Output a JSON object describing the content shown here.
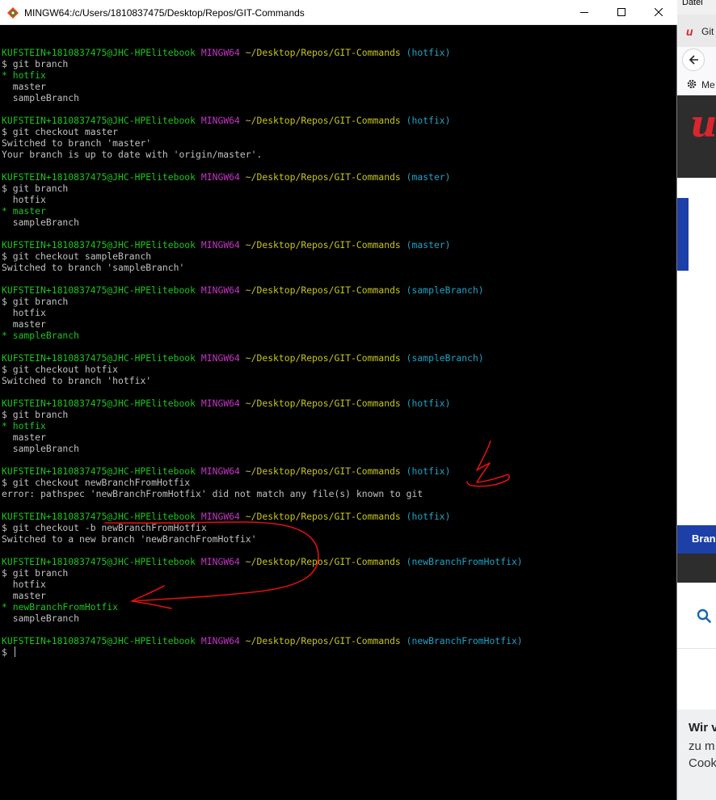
{
  "window": {
    "title": "MINGW64:/c/Users/1810837475/Desktop/Repos/GIT-Commands"
  },
  "colors": {
    "background": "#000000",
    "text": "#c0c0c0",
    "user_host": "#1cc51c",
    "shell_name": "#c535c5",
    "path": "#c6c51c",
    "branch": "#1fa3c5",
    "current_branch": "#1cc51c",
    "annotation": "#e01010"
  },
  "terminal": {
    "lines": [
      {
        "type": "blank"
      },
      {
        "type": "prompt",
        "user": "KUFSTEIN+1810837475@JHC-HPElitebook",
        "shell": "MINGW64",
        "path": "~/Desktop/Repos/GIT-Commands",
        "branch": "(hotfix)"
      },
      {
        "type": "text",
        "text": "$ git branch"
      },
      {
        "type": "current",
        "text": "* hotfix"
      },
      {
        "type": "text",
        "text": "  master"
      },
      {
        "type": "text",
        "text": "  sampleBranch"
      },
      {
        "type": "blank"
      },
      {
        "type": "prompt",
        "user": "KUFSTEIN+1810837475@JHC-HPElitebook",
        "shell": "MINGW64",
        "path": "~/Desktop/Repos/GIT-Commands",
        "branch": "(hotfix)"
      },
      {
        "type": "text",
        "text": "$ git checkout master"
      },
      {
        "type": "text",
        "text": "Switched to branch 'master'"
      },
      {
        "type": "text",
        "text": "Your branch is up to date with 'origin/master'."
      },
      {
        "type": "blank"
      },
      {
        "type": "prompt",
        "user": "KUFSTEIN+1810837475@JHC-HPElitebook",
        "shell": "MINGW64",
        "path": "~/Desktop/Repos/GIT-Commands",
        "branch": "(master)"
      },
      {
        "type": "text",
        "text": "$ git branch"
      },
      {
        "type": "text",
        "text": "  hotfix"
      },
      {
        "type": "current",
        "text": "* master"
      },
      {
        "type": "text",
        "text": "  sampleBranch"
      },
      {
        "type": "blank"
      },
      {
        "type": "prompt",
        "user": "KUFSTEIN+1810837475@JHC-HPElitebook",
        "shell": "MINGW64",
        "path": "~/Desktop/Repos/GIT-Commands",
        "branch": "(master)"
      },
      {
        "type": "text",
        "text": "$ git checkout sampleBranch"
      },
      {
        "type": "text",
        "text": "Switched to branch 'sampleBranch'"
      },
      {
        "type": "blank"
      },
      {
        "type": "prompt",
        "user": "KUFSTEIN+1810837475@JHC-HPElitebook",
        "shell": "MINGW64",
        "path": "~/Desktop/Repos/GIT-Commands",
        "branch": "(sampleBranch)"
      },
      {
        "type": "text",
        "text": "$ git branch"
      },
      {
        "type": "text",
        "text": "  hotfix"
      },
      {
        "type": "text",
        "text": "  master"
      },
      {
        "type": "current",
        "text": "* sampleBranch"
      },
      {
        "type": "blank"
      },
      {
        "type": "prompt",
        "user": "KUFSTEIN+1810837475@JHC-HPElitebook",
        "shell": "MINGW64",
        "path": "~/Desktop/Repos/GIT-Commands",
        "branch": "(sampleBranch)"
      },
      {
        "type": "text",
        "text": "$ git checkout hotfix"
      },
      {
        "type": "text",
        "text": "Switched to branch 'hotfix'"
      },
      {
        "type": "blank"
      },
      {
        "type": "prompt",
        "user": "KUFSTEIN+1810837475@JHC-HPElitebook",
        "shell": "MINGW64",
        "path": "~/Desktop/Repos/GIT-Commands",
        "branch": "(hotfix)"
      },
      {
        "type": "text",
        "text": "$ git branch"
      },
      {
        "type": "current",
        "text": "* hotfix"
      },
      {
        "type": "text",
        "text": "  master"
      },
      {
        "type": "text",
        "text": "  sampleBranch"
      },
      {
        "type": "blank"
      },
      {
        "type": "prompt",
        "user": "KUFSTEIN+1810837475@JHC-HPElitebook",
        "shell": "MINGW64",
        "path": "~/Desktop/Repos/GIT-Commands",
        "branch": "(hotfix)"
      },
      {
        "type": "text",
        "text": "$ git checkout newBranchFromHotfix"
      },
      {
        "type": "text",
        "text": "error: pathspec 'newBranchFromHotfix' did not match any file(s) known to git"
      },
      {
        "type": "blank"
      },
      {
        "type": "prompt",
        "user": "KUFSTEIN+1810837475@JHC-HPElitebook",
        "shell": "MINGW64",
        "path": "~/Desktop/Repos/GIT-Commands",
        "branch": "(hotfix)"
      },
      {
        "type": "text",
        "text": "$ git checkout -b newBranchFromHotfix"
      },
      {
        "type": "text",
        "text": "Switched to a new branch 'newBranchFromHotfix'"
      },
      {
        "type": "blank"
      },
      {
        "type": "prompt",
        "user": "KUFSTEIN+1810837475@JHC-HPElitebook",
        "shell": "MINGW64",
        "path": "~/Desktop/Repos/GIT-Commands",
        "branch": "(newBranchFromHotfix)"
      },
      {
        "type": "text",
        "text": "$ git branch"
      },
      {
        "type": "text",
        "text": "  hotfix"
      },
      {
        "type": "text",
        "text": "  master"
      },
      {
        "type": "current",
        "text": "* newBranchFromHotfix"
      },
      {
        "type": "text",
        "text": "  sampleBranch"
      },
      {
        "type": "blank"
      },
      {
        "type": "prompt",
        "user": "KUFSTEIN+1810837475@JHC-HPElitebook",
        "shell": "MINGW64",
        "path": "~/Desktop/Repos/GIT-Commands",
        "branch": "(newBranchFromHotfix)"
      },
      {
        "type": "input",
        "text": "$ "
      }
    ]
  },
  "background_browser": {
    "menu_label": "Datei",
    "tab_logo": "u",
    "tab_label": "Git",
    "bookmark_label": "Me",
    "hero_logo": "u",
    "nav_label": "Bran",
    "cookie_title": "Wir v",
    "cookie_line1": "zu m",
    "cookie_line2": "Cook"
  }
}
